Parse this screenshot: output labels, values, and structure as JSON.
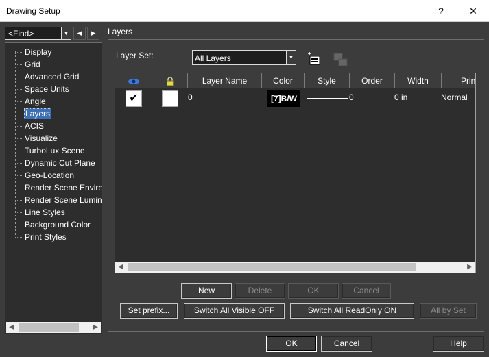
{
  "window": {
    "title": "Drawing Setup",
    "help_glyph": "?",
    "close_glyph": "✕"
  },
  "find": {
    "value": "<Find>",
    "prev_glyph": "◀",
    "next_glyph": "▶"
  },
  "tree": {
    "items": [
      {
        "label": "Display"
      },
      {
        "label": "Grid"
      },
      {
        "label": "Advanced Grid"
      },
      {
        "label": "Space Units"
      },
      {
        "label": "Angle"
      },
      {
        "label": "Layers",
        "selected": true
      },
      {
        "label": "ACIS"
      },
      {
        "label": "Visualize"
      },
      {
        "label": "TurboLux Scene"
      },
      {
        "label": "Dynamic Cut Plane"
      },
      {
        "label": "Geo-Location"
      },
      {
        "label": "Render Scene Environment"
      },
      {
        "label": "Render Scene Luminance"
      },
      {
        "label": "Line Styles"
      },
      {
        "label": "Background Color"
      },
      {
        "label": "Print Styles"
      }
    ]
  },
  "section": {
    "title": "Layers"
  },
  "layer_set": {
    "label": "Layer Set:",
    "value": "All Layers"
  },
  "grid": {
    "columns": [
      {
        "key": "visible",
        "label": ""
      },
      {
        "key": "lock",
        "label": ""
      },
      {
        "key": "name",
        "label": "Layer Name"
      },
      {
        "key": "color",
        "label": "Color"
      },
      {
        "key": "style",
        "label": "Style"
      },
      {
        "key": "order",
        "label": "Order"
      },
      {
        "key": "width",
        "label": "Width"
      },
      {
        "key": "print",
        "label": "Print"
      }
    ],
    "rows": [
      {
        "visible": true,
        "locked": false,
        "name": "0",
        "color": "[7]B/W",
        "style_value": "0",
        "width": "0 in",
        "print": "Normal"
      }
    ]
  },
  "buttons": {
    "new": "New",
    "delete": "Delete",
    "ok_row": "OK",
    "cancel_row": "Cancel",
    "set_prefix": "Set prefix...",
    "switch_visible_off": "Switch All Visible OFF",
    "switch_readonly_on": "Switch All ReadOnly ON",
    "all_by_set": "All by Set",
    "ok": "OK",
    "cancel": "Cancel",
    "help": "Help"
  },
  "colors": {
    "background": "#3c3c3c",
    "panel": "#2d2d2d",
    "selection": "#3c6fb4"
  }
}
